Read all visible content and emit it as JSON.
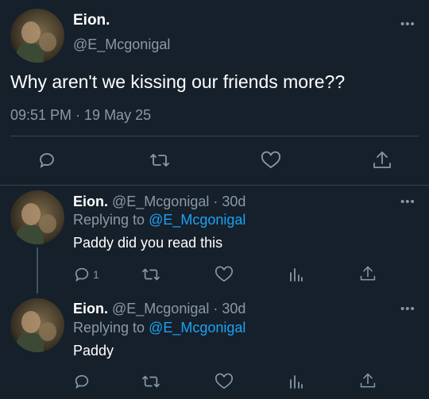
{
  "main_tweet": {
    "author_name": "Eion.",
    "author_handle": "@E_Mcgonigal",
    "text": "Why aren't we kissing our friends more??",
    "timestamp": "09:51 PM · 19 May 25",
    "more_icon": "ellipsis-icon",
    "actions": [
      "reply-icon",
      "retweet-icon",
      "like-icon",
      "share-icon"
    ]
  },
  "replies": [
    {
      "author_name": "Eion.",
      "author_handle": "@E_Mcgonigal",
      "age": "· 30d",
      "replying_prefix": "Replying to",
      "replying_handle": "@E_Mcgonigal",
      "text": "Paddy did you read this",
      "reply_count": "1"
    },
    {
      "author_name": "Eion.",
      "author_handle": "@E_Mcgonigal",
      "age": "· 30d",
      "replying_prefix": "Replying to",
      "replying_handle": "@E_Mcgonigal",
      "text": "Paddy",
      "reply_count": ""
    }
  ],
  "colors": {
    "background": "#15202b",
    "secondary_text": "#8899a6",
    "link": "#1da1f2",
    "divider": "#38444d"
  }
}
